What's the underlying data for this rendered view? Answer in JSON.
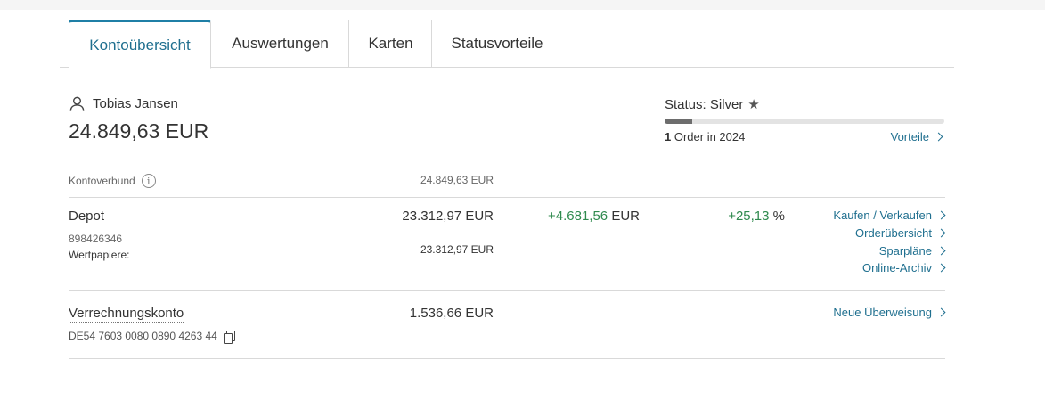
{
  "tabs": [
    {
      "label": "Kontoübersicht",
      "active": true
    },
    {
      "label": "Auswertungen",
      "active": false
    },
    {
      "label": "Karten",
      "active": false
    },
    {
      "label": "Statusvorteile",
      "active": false
    }
  ],
  "holder": {
    "name": "Tobias Jansen",
    "icon": "user-icon"
  },
  "total_balance": "24.849,63 EUR",
  "status": {
    "label": "Status: Silver",
    "icon": "star-icon",
    "progress_fraction": 0.1,
    "orders_count": "1",
    "orders_text": " Order in 2024",
    "benefits_link": "Vorteile"
  },
  "kontoverbund": {
    "label": "Kontoverbund",
    "icon": "info-icon",
    "value": "24.849,63 EUR"
  },
  "depot": {
    "name": "Depot",
    "number": "898426346",
    "sub_label": "Wertpapiere:",
    "value": "23.312,97 EUR",
    "sub_value": "23.312,97 EUR",
    "gain_amount": "+4.681,56",
    "gain_currency": " EUR",
    "gain_pct": "+25,13",
    "gain_pct_unit": " %",
    "links": [
      "Kaufen / Verkaufen",
      "Orderübersicht",
      "Sparpläne",
      "Online-Archiv"
    ]
  },
  "verrechnungskonto": {
    "name": "Verrechnungskonto",
    "iban": "DE54 7603 0080 0890 4263 44",
    "value": "1.536,66 EUR",
    "link": "Neue Überweisung"
  },
  "colors": {
    "accent": "#1f6f8f",
    "positive": "#2f8a4e",
    "tab_active_border": "#1f7fa6"
  }
}
